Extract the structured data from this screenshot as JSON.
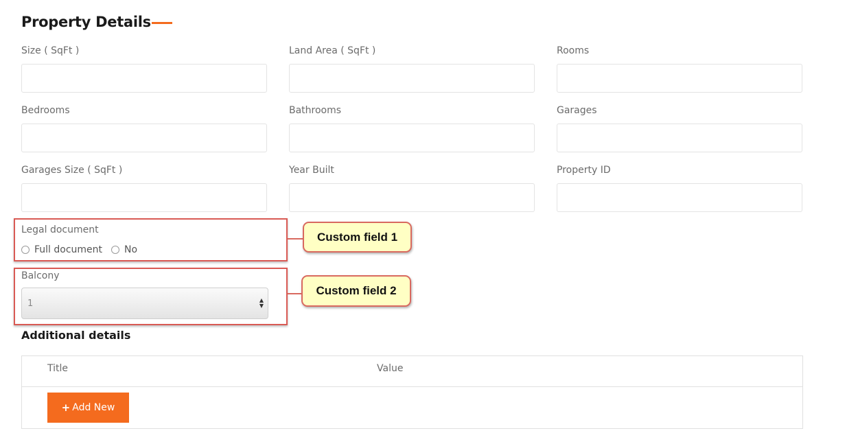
{
  "section": {
    "title": "Property Details"
  },
  "fields": {
    "size": {
      "label": "Size ( SqFt )",
      "value": "",
      "placeholder": ""
    },
    "land_area": {
      "label": "Land Area ( SqFt )",
      "value": "",
      "placeholder": ""
    },
    "rooms": {
      "label": "Rooms",
      "value": "",
      "placeholder": ""
    },
    "bedrooms": {
      "label": "Bedrooms",
      "value": "",
      "placeholder": ""
    },
    "bathrooms": {
      "label": "Bathrooms",
      "value": "",
      "placeholder": ""
    },
    "garages": {
      "label": "Garages",
      "value": "",
      "placeholder": ""
    },
    "garages_size": {
      "label": "Garages Size ( SqFt )",
      "value": "",
      "placeholder": ""
    },
    "year_built": {
      "label": "Year Built",
      "value": "",
      "placeholder": ""
    },
    "property_id": {
      "label": "Property ID",
      "value": "",
      "placeholder": ""
    }
  },
  "legal_document": {
    "label": "Legal document",
    "options": [
      "Full document",
      "No"
    ]
  },
  "balcony": {
    "label": "Balcony",
    "selected": "1"
  },
  "callouts": {
    "first": "Custom field 1",
    "second": "Custom field 2"
  },
  "additional": {
    "heading": "Additional details",
    "columns": {
      "title": "Title",
      "value": "Value"
    },
    "add_button": "Add New"
  },
  "colors": {
    "accent": "#f46b1e",
    "callout_fill": "#ffffc4",
    "callout_border": "#d9695f"
  }
}
